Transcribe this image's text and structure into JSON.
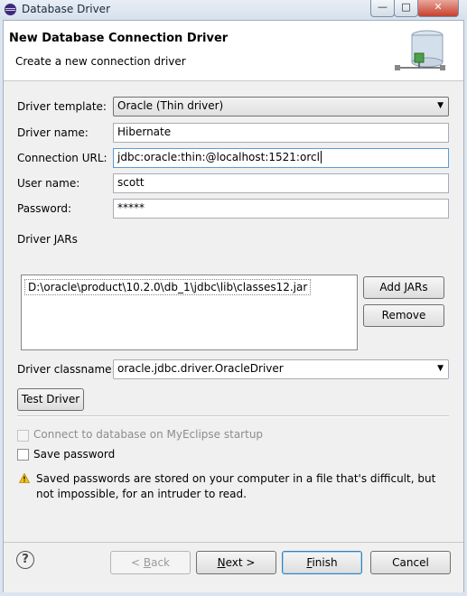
{
  "window": {
    "title": "Database Driver"
  },
  "banner": {
    "heading": "New Database Connection Driver",
    "subtitle": "Create a new connection driver"
  },
  "form": {
    "template_label": "Driver template:",
    "template_value": "Oracle (Thin driver)",
    "name_label": "Driver name:",
    "name_value": "Hibernate",
    "url_label": "Connection URL:",
    "url_value": "jdbc:oracle:thin:@localhost:1521:orcl",
    "user_label": "User name:",
    "user_value": "scott",
    "password_label": "Password:",
    "password_value": "*****",
    "jars_label": "Driver JARs",
    "jars": [
      "D:\\oracle\\product\\10.2.0\\db_1\\jdbc\\lib\\classes12.jar"
    ],
    "add_jars": "Add JARs",
    "remove": "Remove",
    "classname_label": "Driver classname:",
    "classname_value": "oracle.jdbc.driver.OracleDriver",
    "test_driver": "Test Driver",
    "connect_startup": "Connect to database on MyEclipse startup",
    "save_password": "Save password",
    "warning_line1": "Saved passwords are stored on your computer in a file that's difficult, but",
    "warning_line2": "not impossible, for an intruder to read."
  },
  "footer": {
    "help": "?",
    "back_prefix": "< ",
    "back_u": "B",
    "back_rest": "ack",
    "next_u": "N",
    "next_rest": "ext >",
    "finish_u": "F",
    "finish_rest": "inish",
    "cancel": "Cancel"
  }
}
